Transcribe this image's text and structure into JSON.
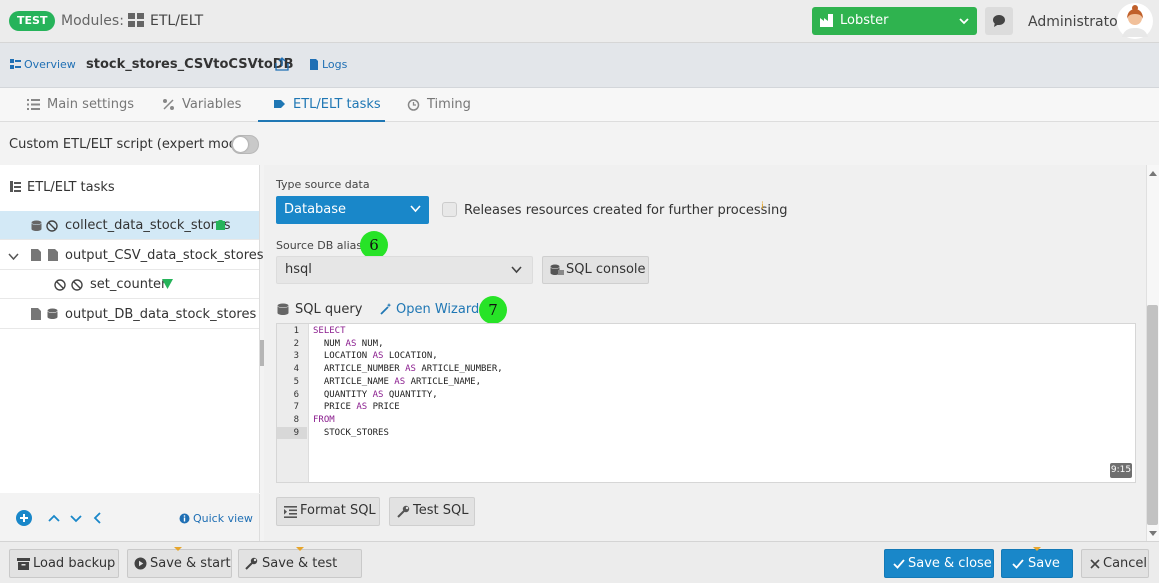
{
  "header": {
    "env_badge": "TEST",
    "modules_label": "Modules:",
    "module_name": "ETL/ELT",
    "tenant_select": "Lobster",
    "user_name": "Administrator",
    "brand_color": "#2fb34f",
    "accent_color": "#1987c9"
  },
  "subheader": {
    "overview_link": "Overview",
    "job_name": "stock_stores_CSVtoCSVtoDB",
    "logs_link": "Logs"
  },
  "tabs": [
    {
      "label": "Main settings",
      "icon": "list-icon"
    },
    {
      "label": "Variables",
      "icon": "percent-icon"
    },
    {
      "label": "ETL/ELT tasks",
      "icon": "tasks-icon",
      "active": true
    },
    {
      "label": "Timing",
      "icon": "clock-icon"
    }
  ],
  "expert_mode": {
    "label": "Custom ETL/ELT script (expert mode)",
    "enabled": false
  },
  "task_tree": {
    "title": "ETL/ELT tasks",
    "items": [
      {
        "label": "collect_data_stock_stores",
        "selected": true
      },
      {
        "label": "output_CSV_data_stock_stores",
        "expanded": true
      },
      {
        "label": "set_counter"
      },
      {
        "label": "output_DB_data_stock_stores"
      }
    ],
    "quick_view": "Quick view"
  },
  "form": {
    "type_source_label": "Type source data",
    "type_source_value": "Database",
    "release_resources_label": "Releases resources created for further processing",
    "release_resources_checked": false,
    "info_mark": "i",
    "marker_6": "6",
    "source_alias_label": "Source DB alias",
    "source_alias_value": "hsql",
    "sql_console_button": "SQL console",
    "sql_query_label": "SQL query",
    "open_wizard_link": "Open Wizard",
    "marker_7": "7",
    "editor": {
      "line_numbers": [
        "1",
        "2",
        "3",
        "4",
        "5",
        "6",
        "7",
        "8",
        "9"
      ],
      "lines": [
        "SELECT",
        "  NUM AS NUM,",
        "  LOCATION AS LOCATION,",
        "  ARTICLE_NUMBER AS ARTICLE_NUMBER,",
        "  ARTICLE_NAME AS ARTICLE_NAME,",
        "  QUANTITY AS QUANTITY,",
        "  PRICE AS PRICE",
        "FROM",
        "  STOCK_STORES"
      ],
      "cursor_position": "9:15"
    },
    "format_sql_button": "Format SQL",
    "test_sql_button": "Test SQL"
  },
  "footer": {
    "load_backup": "Load backup",
    "save_start": "Save & start",
    "save_test_run": "Save & test run",
    "save_close": "Save & close",
    "save": "Save",
    "cancel": "Cancel"
  }
}
